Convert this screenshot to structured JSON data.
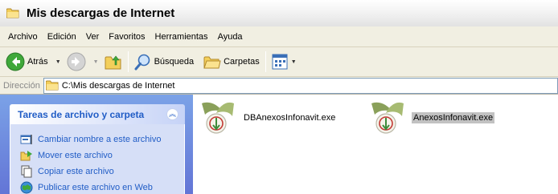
{
  "window": {
    "title": "Mis descargas de Internet"
  },
  "menu": [
    "Archivo",
    "Edición",
    "Ver",
    "Favoritos",
    "Herramientas",
    "Ayuda"
  ],
  "toolbar": {
    "back_label": "Atrás",
    "search_label": "Búsqueda",
    "folders_label": "Carpetas"
  },
  "address": {
    "label": "Dirección",
    "value": "C:\\Mis descargas de Internet"
  },
  "tasks_panel": {
    "title": "Tareas de archivo y carpeta",
    "items": [
      {
        "label": "Cambiar nombre a este archivo",
        "icon": "rename-icon"
      },
      {
        "label": "Mover este archivo",
        "icon": "move-icon"
      },
      {
        "label": "Copiar este archivo",
        "icon": "copy-icon"
      },
      {
        "label": "Publicar este archivo en Web",
        "icon": "publish-web-icon"
      }
    ]
  },
  "files": [
    {
      "name": "DBAnexosInfonavit.exe",
      "icon": "infonavit-exe-icon",
      "selected": false
    },
    {
      "name": "AnexosInfonavit.exe",
      "icon": "infonavit-exe-icon",
      "selected": true
    }
  ],
  "colors": {
    "task_link": "#215dc6",
    "taskpane_bg": "#6375d6",
    "selection": "#c2c2c2"
  }
}
